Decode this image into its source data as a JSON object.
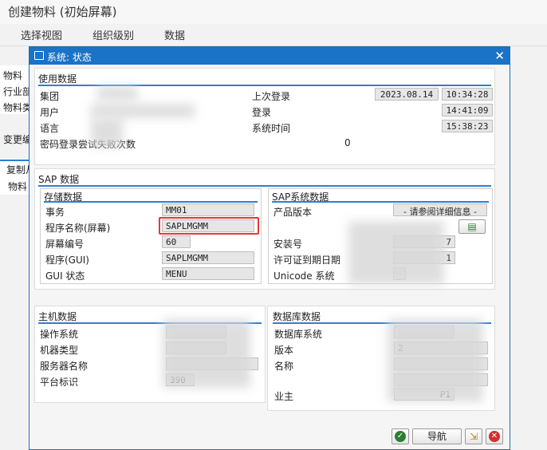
{
  "window": {
    "title": "创建物料 (初始屏幕)"
  },
  "menu": [
    "选择视图",
    "组织级别",
    "数据"
  ],
  "background": {
    "labels": [
      "物料",
      "行业部",
      "物料类",
      "变更编",
      "复制从",
      "物料"
    ]
  },
  "dialog": {
    "title": "系统: 状态",
    "usage": {
      "title": "使用数据",
      "labels": {
        "client": "集团",
        "user": "用户",
        "language": "语言",
        "pwd": "密码登录尝试失败次数",
        "last_logon": "上次登录",
        "logon": "登录",
        "system_time": "系统时间"
      },
      "values": {
        "pwd_count": "0",
        "last_logon_date": "2023.08.14",
        "last_logon_time": "10:34:28",
        "logon_time": "14:41:09",
        "system_time": "15:38:23"
      }
    },
    "sap_data": {
      "title": "SAP 数据",
      "repo": {
        "title": "存储数据",
        "labels": {
          "transaction": "事务",
          "program": "程序名称(屏幕)",
          "screen": "屏幕编号",
          "program_gui": "程序(GUI)",
          "gui_status": "GUI 状态"
        },
        "values": {
          "transaction": "MM01",
          "program": "SAPLMGMM",
          "screen": "60",
          "program_gui": "SAPLMGMM",
          "gui_status": "MENU"
        }
      },
      "system": {
        "title": "SAP系统数据",
        "labels": {
          "product_version": "产品版本",
          "install_no": "安装号",
          "license_expiry": "许可证到期日期",
          "unicode": "Unicode 系统"
        },
        "values": {
          "product_version": "- 请参阅详细信息 -",
          "install_no_tail": "7",
          "license_tail": "1"
        }
      }
    },
    "host": {
      "title": "主机数据",
      "labels": {
        "os": "操作系统",
        "machine": "机器类型",
        "server": "服务器名称",
        "platform": "平台标识"
      },
      "values": {
        "platform_tail": "390"
      }
    },
    "db": {
      "title": "数据库数据",
      "labels": {
        "db_system": "数据库系统",
        "release": "版本",
        "name": "名称",
        "host": "",
        "owner": "业主"
      },
      "values": {
        "release_head": "2",
        "owner_tail": "P1"
      }
    },
    "buttons": {
      "navigate": "导航"
    }
  }
}
